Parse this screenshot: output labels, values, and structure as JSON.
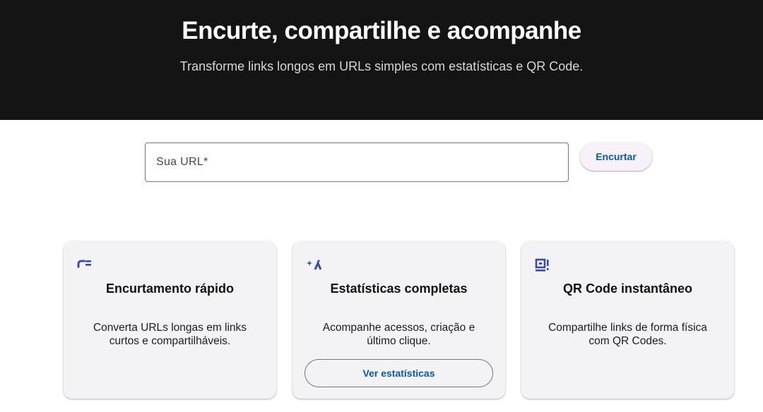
{
  "hero": {
    "title": "Encurte, compartilhe e acompanhe",
    "subtitle": "Transforme links longos em URLs simples com estatísticas e QR Code."
  },
  "form": {
    "url_placeholder": "Sua URL*",
    "url_value": "",
    "submit_label": "Encurtar"
  },
  "features": [
    {
      "icon": "short-link-icon",
      "title": "Encurtamento rápido",
      "description": "Converta URLs longas em links curtos e compartilháveis."
    },
    {
      "icon": "sparkle-chart-icon",
      "title": "Estatísticas completas",
      "description": "Acompanhe acessos, criação e último clique.",
      "button_label": "Ver estatísticas"
    },
    {
      "icon": "qr-code-icon",
      "title": "QR Code instantâneo",
      "description": "Compartilhe links de forma física com QR Codes."
    }
  ],
  "colors": {
    "hero_bg": "#141414",
    "accent": "#0b57a8",
    "icon": "#3f4aa6",
    "card_bg": "#f3f3f5"
  }
}
